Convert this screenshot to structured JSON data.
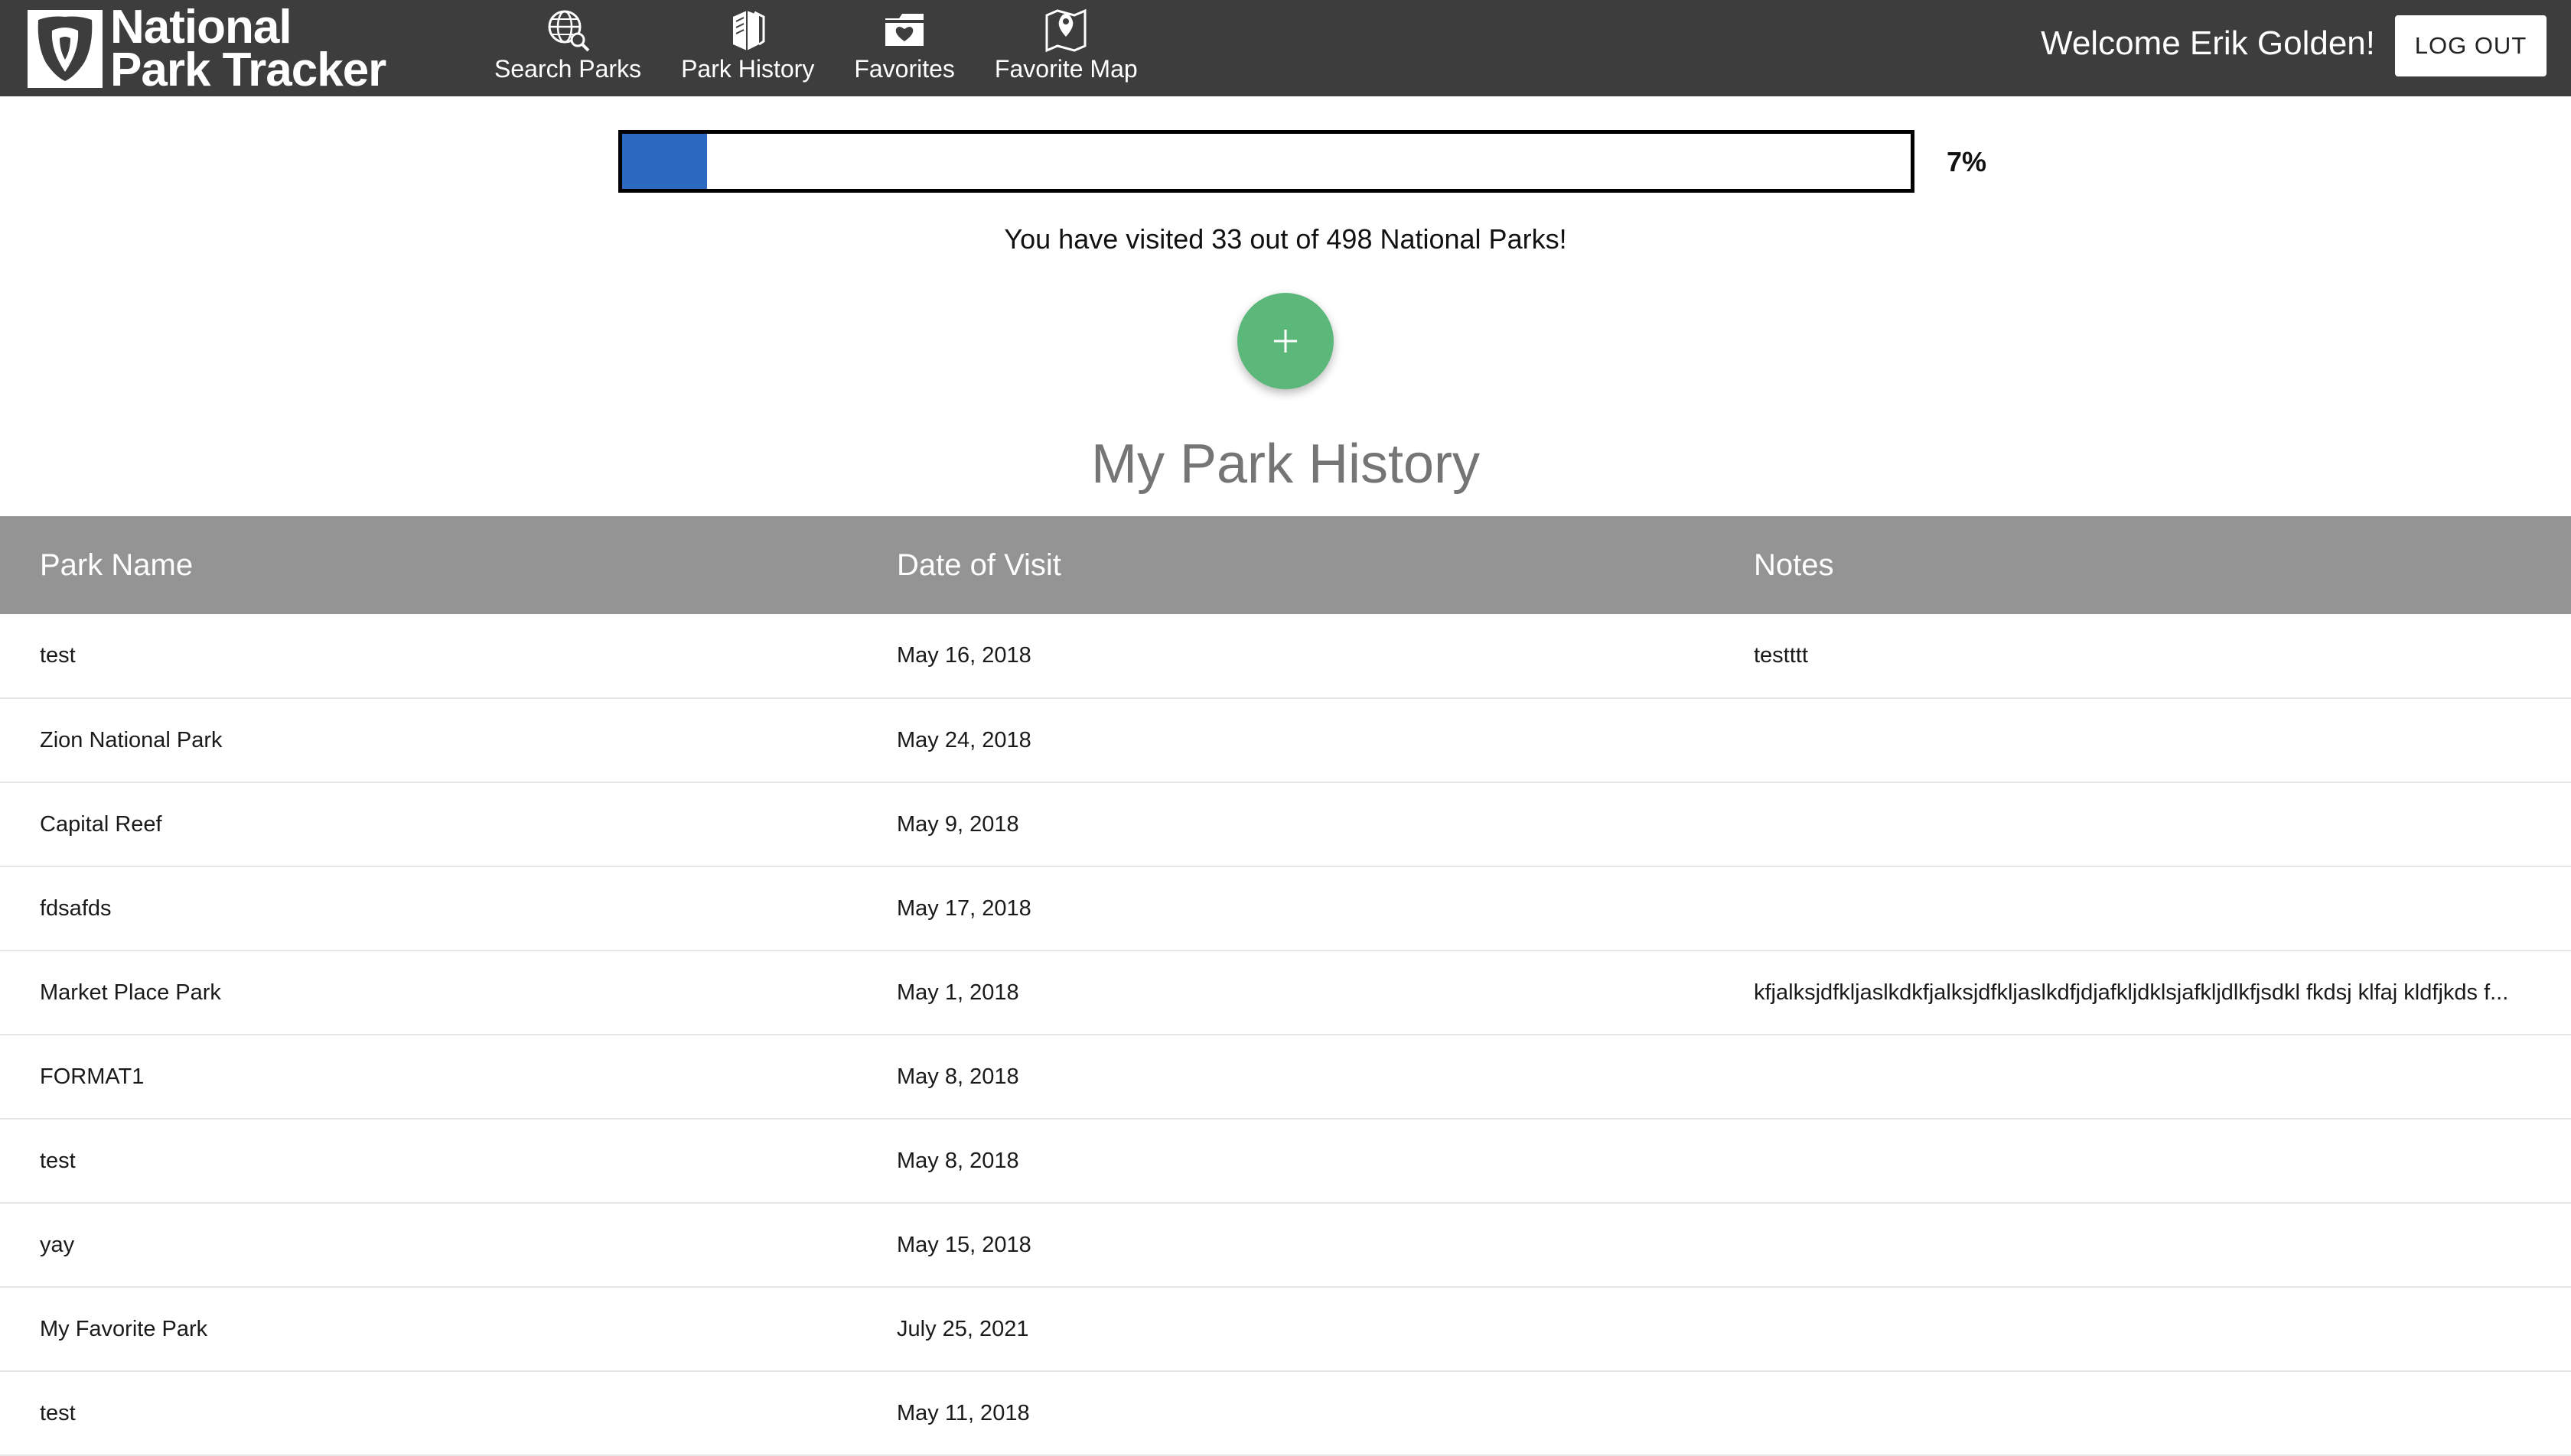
{
  "brand": {
    "line1": "National",
    "line2": "Park Tracker",
    "logo_icon": "arrowhead-shield-icon"
  },
  "nav": {
    "items": [
      {
        "label": "Search Parks",
        "icon": "globe-search-icon"
      },
      {
        "label": "Park History",
        "icon": "books-icon"
      },
      {
        "label": "Favorites",
        "icon": "heart-folder-icon"
      },
      {
        "label": "Favorite Map",
        "icon": "map-pin-icon"
      }
    ]
  },
  "user": {
    "welcome": "Welcome Erik Golden!",
    "logout_label": "LOG OUT"
  },
  "progress": {
    "percent_label": "7%",
    "fraction": 0.066,
    "visited_text": "You have visited 33 out of 498 National Parks!",
    "fill_color": "#2c6ac1"
  },
  "add_button": {
    "icon": "plus-icon",
    "color": "#5cb87a"
  },
  "history": {
    "title": "My Park History",
    "columns": [
      "Park Name",
      "Date of Visit",
      "Notes"
    ],
    "rows": [
      [
        "test",
        "May 16, 2018",
        "testttt"
      ],
      [
        "Zion National Park",
        "May 24, 2018",
        ""
      ],
      [
        "Capital Reef",
        "May 9, 2018",
        ""
      ],
      [
        "fdsafds",
        "May 17, 2018",
        ""
      ],
      [
        "Market Place Park",
        "May 1, 2018",
        "kfjalksjdfkljaslkdkfjalksjdfkljaslkdfjdjafkljdklsjafkljdlkfjsdkl fkdsj klfaj kldfjkds f..."
      ],
      [
        "FORMAT1",
        "May 8, 2018",
        ""
      ],
      [
        "test",
        "May 8, 2018",
        ""
      ],
      [
        "yay",
        "May 15, 2018",
        ""
      ],
      [
        "My Favorite Park",
        "July 25, 2021",
        ""
      ],
      [
        "test",
        "May 11, 2018",
        ""
      ]
    ]
  },
  "colors": {
    "topbar": "#3d3d3d",
    "table_header": "#949494",
    "title": "#757575"
  }
}
